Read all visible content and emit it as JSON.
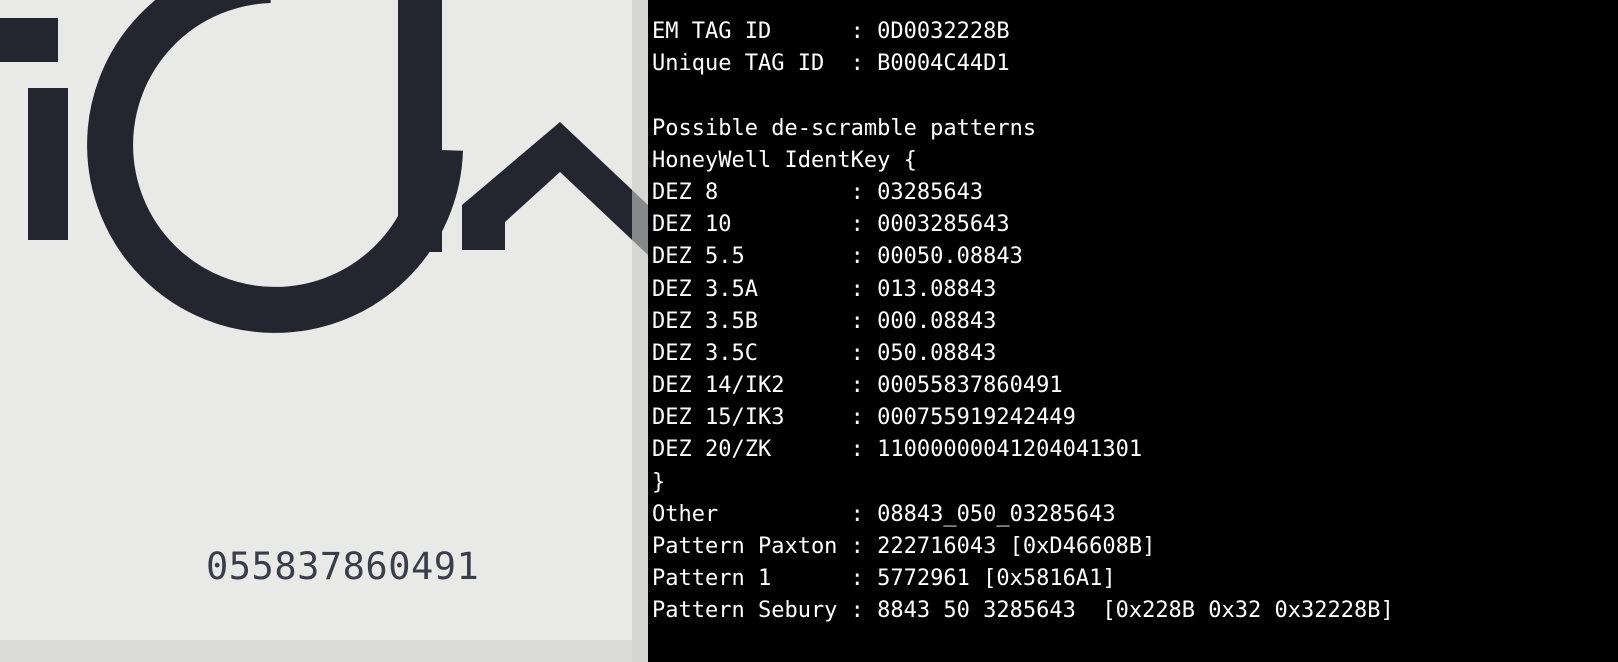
{
  "photo": {
    "card_number": "055837860491"
  },
  "terminal": {
    "lines": [
      "EM TAG ID      : 0D0032228B",
      "Unique TAG ID  : B0004C44D1",
      "",
      "Possible de-scramble patterns",
      "HoneyWell IdentKey {",
      "DEZ 8          : 03285643",
      "DEZ 10         : 0003285643",
      "DEZ 5.5        : 00050.08843",
      "DEZ 3.5A       : 013.08843",
      "DEZ 3.5B       : 000.08843",
      "DEZ 3.5C       : 050.08843",
      "DEZ 14/IK2     : 00055837860491",
      "DEZ 15/IK3     : 000755919242449",
      "DEZ 20/ZK      : 11000000041204041301",
      "}",
      "Other          : 08843_050_03285643",
      "Pattern Paxton : 222716043 [0xD46608B]",
      "Pattern 1      : 5772961 [0x5816A1]",
      "Pattern Sebury : 8843 50 3285643  [0x228B 0x32 0x32228B]"
    ]
  }
}
